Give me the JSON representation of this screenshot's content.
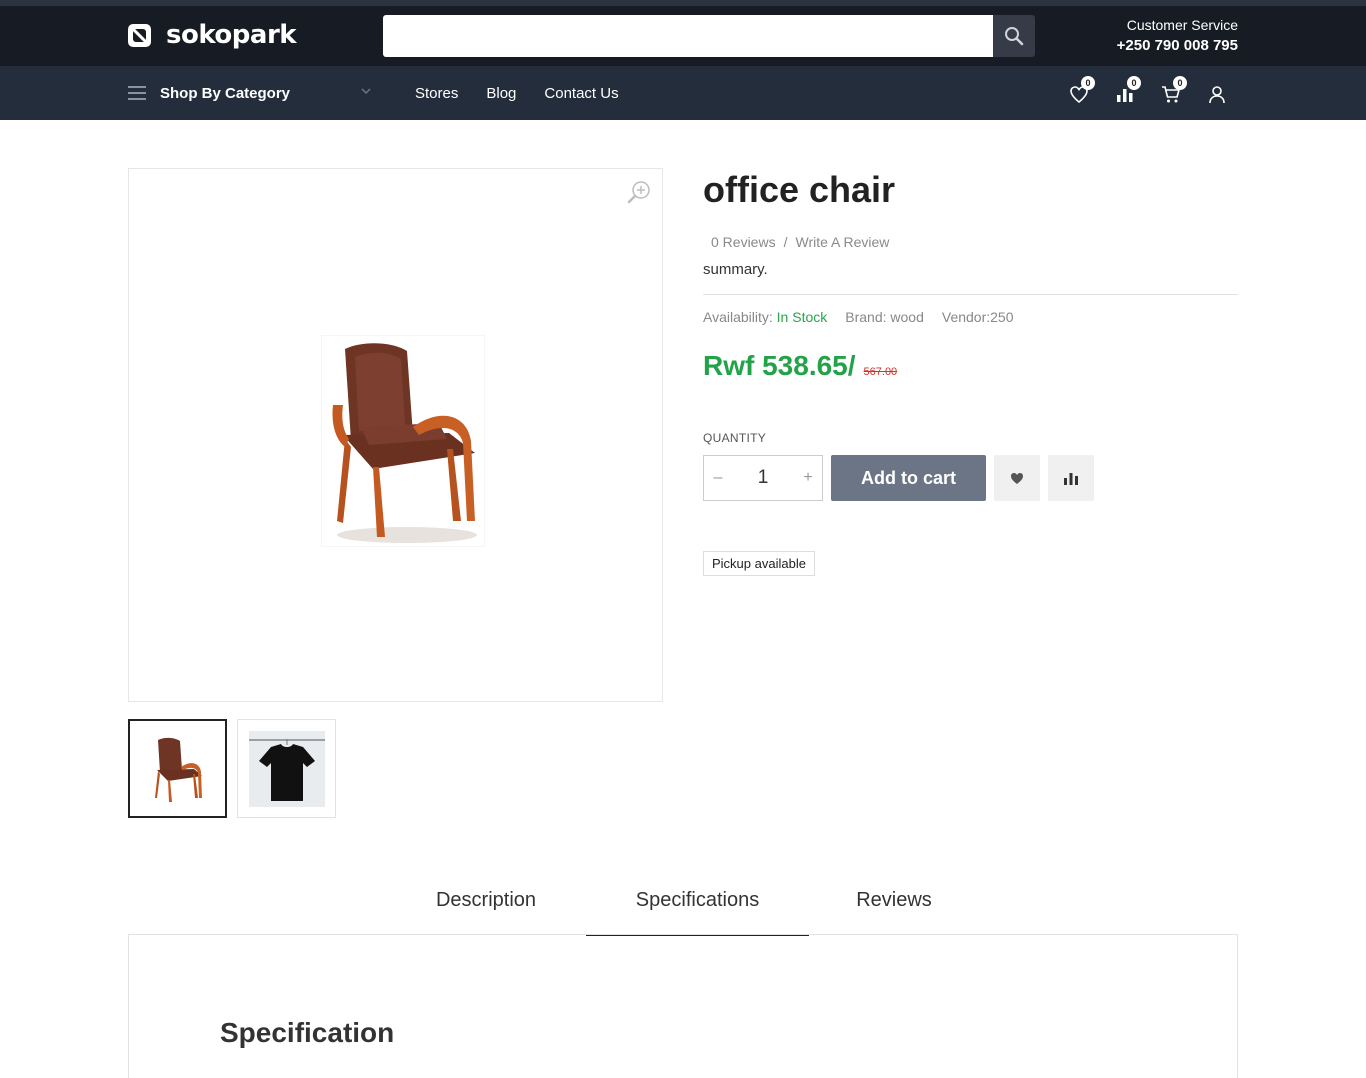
{
  "header": {
    "logo_text": "sokopark",
    "search": {
      "placeholder": "",
      "value": ""
    },
    "customer_service": {
      "label": "Customer Service",
      "phone": "+250 790 008 795"
    }
  },
  "nav": {
    "category_label": "Shop By Category",
    "links": [
      "Stores",
      "Blog",
      "Contact Us"
    ],
    "icons": [
      {
        "name": "wishlist-icon",
        "badge": "0"
      },
      {
        "name": "compare-icon",
        "badge": "0"
      },
      {
        "name": "cart-icon",
        "badge": "0"
      },
      {
        "name": "account-icon"
      }
    ]
  },
  "product": {
    "title": "office chair",
    "reviews_count": "0 Reviews",
    "reviews_sep": "/",
    "write_review": "Write A Review",
    "summary": "summary.",
    "availability_label": "Availability:",
    "availability_value": "In Stock",
    "brand": "Brand: wood",
    "vendor": "Vendor:250",
    "price_now": "Rwf 538.65/",
    "price_old": "567.00",
    "quantity_label": "QUANTITY",
    "quantity_value": "1",
    "minus": "–",
    "plus": "+",
    "add_to_cart": "Add to cart",
    "pickup": "Pickup available"
  },
  "tabs": {
    "items": [
      "Description",
      "Specifications",
      "Reviews"
    ],
    "active": "Specifications"
  },
  "panel": {
    "heading": "Specification"
  },
  "colors": {
    "header_bg": "#161b24",
    "nav_bg": "#242d3c",
    "price_green": "#22a34a",
    "old_price_red": "#d0312d",
    "button_gray": "#6c7585"
  }
}
